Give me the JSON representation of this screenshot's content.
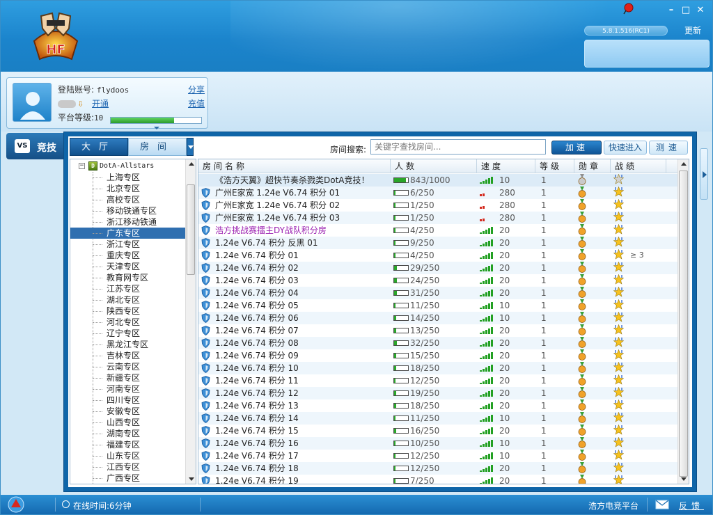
{
  "header": {
    "version": "5.8.1.516(RC1)",
    "update_label": "更新",
    "controls": [
      "minimize",
      "maximize",
      "close"
    ]
  },
  "user": {
    "account_label": "登陆账号:",
    "account": "flydoos",
    "share_label": "分享",
    "vip_open_label": "开通",
    "recharge_label": "充值",
    "level_label": "平台等级:",
    "level": "10",
    "level_progress": 0.7
  },
  "nav": {
    "compete_label": "竞技"
  },
  "tabs": {
    "hall": "大厅",
    "room": "房间"
  },
  "search": {
    "label": "房间搜索:",
    "placeholder": "关键字查找房间..."
  },
  "buttons": {
    "accelerate": "加速",
    "quick_enter": "快速进入",
    "speed_test": "测速"
  },
  "tree": {
    "root": "DotA-Allstars",
    "root_icon_letter": "D",
    "items": [
      "上海专区",
      "北京专区",
      "高校专区",
      "移动铁通专区",
      "浙江移动铁通",
      "广东专区",
      "浙江专区",
      "重庆专区",
      "天津专区",
      "教育网专区",
      "江苏专区",
      "湖北专区",
      "陕西专区",
      "河北专区",
      "辽宁专区",
      "黑龙江专区",
      "吉林专区",
      "云南专区",
      "新疆专区",
      "河南专区",
      "四川专区",
      "安徽专区",
      "山西专区",
      "湖南专区",
      "福建专区",
      "山东专区",
      "江西专区",
      "广西专区"
    ],
    "selected_index": 5
  },
  "table": {
    "columns": [
      "房间名称",
      "人数",
      "速度",
      "等级",
      "勋章",
      "战绩"
    ],
    "rows": [
      {
        "name": "《浩方天翼》超快节奏杀戮类DotA竞技！",
        "people": "843/1000",
        "fill": 0.84,
        "speed": "10",
        "sig": "green",
        "level": "1",
        "medal": "silver",
        "rec": "silver",
        "shield": false,
        "color": "#222",
        "extra": ""
      },
      {
        "name": "广州E家宽 1.24e V6.74 积分 01",
        "people": "6/250",
        "fill": 0.1,
        "speed": "280",
        "sig": "red",
        "level": "1",
        "medal": "gold",
        "rec": "gold",
        "shield": true,
        "color": "#222",
        "extra": ""
      },
      {
        "name": "广州E家宽 1.24e V6.74 积分 02",
        "people": "1/250",
        "fill": 0.05,
        "speed": "280",
        "sig": "red",
        "level": "1",
        "medal": "gold",
        "rec": "gold",
        "shield": true,
        "color": "#222",
        "extra": ""
      },
      {
        "name": "广州E家宽 1.24e V6.74 积分 03",
        "people": "1/250",
        "fill": 0.05,
        "speed": "280",
        "sig": "red",
        "level": "1",
        "medal": "gold",
        "rec": "gold",
        "shield": true,
        "color": "#222",
        "extra": ""
      },
      {
        "name": "浩方挑战赛擂主DY战队积分房",
        "people": "4/250",
        "fill": 0.08,
        "speed": "20",
        "sig": "green",
        "level": "1",
        "medal": "gold",
        "rec": "gold",
        "shield": true,
        "color": "#9b1fb0",
        "extra": ""
      },
      {
        "name": "1.24e V6.74 积分 反黑 01",
        "people": "9/250",
        "fill": 0.1,
        "speed": "20",
        "sig": "green",
        "level": "1",
        "medal": "gold",
        "rec": "gold",
        "shield": true,
        "color": "#222",
        "extra": ""
      },
      {
        "name": "1.24e V6.74 积分 01",
        "people": "4/250",
        "fill": 0.08,
        "speed": "20",
        "sig": "green",
        "level": "1",
        "medal": "gold",
        "rec": "gold",
        "shield": true,
        "color": "#222",
        "extra": "≥ 3"
      },
      {
        "name": "1.24e V6.74 积分 02",
        "people": "29/250",
        "fill": 0.2,
        "speed": "20",
        "sig": "green",
        "level": "1",
        "medal": "gold",
        "rec": "gold",
        "shield": true,
        "color": "#222",
        "extra": ""
      },
      {
        "name": "1.24e V6.74 积分 03",
        "people": "24/250",
        "fill": 0.18,
        "speed": "20",
        "sig": "green",
        "level": "1",
        "medal": "gold",
        "rec": "gold",
        "shield": true,
        "color": "#222",
        "extra": ""
      },
      {
        "name": "1.24e V6.74 积分 04",
        "people": "31/250",
        "fill": 0.22,
        "speed": "20",
        "sig": "green",
        "level": "1",
        "medal": "gold",
        "rec": "gold",
        "shield": true,
        "color": "#222",
        "extra": ""
      },
      {
        "name": "1.24e V6.74 积分 05",
        "people": "11/250",
        "fill": 0.12,
        "speed": "10",
        "sig": "green",
        "level": "1",
        "medal": "gold",
        "rec": "gold",
        "shield": true,
        "color": "#222",
        "extra": ""
      },
      {
        "name": "1.24e V6.74 积分 06",
        "people": "14/250",
        "fill": 0.14,
        "speed": "10",
        "sig": "green",
        "level": "1",
        "medal": "gold",
        "rec": "gold",
        "shield": true,
        "color": "#222",
        "extra": ""
      },
      {
        "name": "1.24e V6.74 积分 07",
        "people": "13/250",
        "fill": 0.13,
        "speed": "20",
        "sig": "green",
        "level": "1",
        "medal": "gold",
        "rec": "gold",
        "shield": true,
        "color": "#222",
        "extra": ""
      },
      {
        "name": "1.24e V6.74 积分 08",
        "people": "32/250",
        "fill": 0.22,
        "speed": "20",
        "sig": "green",
        "level": "1",
        "medal": "gold",
        "rec": "gold",
        "shield": true,
        "color": "#222",
        "extra": ""
      },
      {
        "name": "1.24e V6.74 积分 09",
        "people": "15/250",
        "fill": 0.14,
        "speed": "20",
        "sig": "green",
        "level": "1",
        "medal": "gold",
        "rec": "gold",
        "shield": true,
        "color": "#222",
        "extra": ""
      },
      {
        "name": "1.24e V6.74 积分 10",
        "people": "18/250",
        "fill": 0.16,
        "speed": "20",
        "sig": "green",
        "level": "1",
        "medal": "gold",
        "rec": "gold",
        "shield": true,
        "color": "#222",
        "extra": ""
      },
      {
        "name": "1.24e V6.74 积分 11",
        "people": "12/250",
        "fill": 0.12,
        "speed": "20",
        "sig": "green",
        "level": "1",
        "medal": "gold",
        "rec": "gold",
        "shield": true,
        "color": "#222",
        "extra": ""
      },
      {
        "name": "1.24e V6.74 积分 12",
        "people": "19/250",
        "fill": 0.16,
        "speed": "20",
        "sig": "green",
        "level": "1",
        "medal": "gold",
        "rec": "gold",
        "shield": true,
        "color": "#222",
        "extra": ""
      },
      {
        "name": "1.24e V6.74 积分 13",
        "people": "18/250",
        "fill": 0.16,
        "speed": "20",
        "sig": "green",
        "level": "1",
        "medal": "gold",
        "rec": "gold",
        "shield": true,
        "color": "#222",
        "extra": ""
      },
      {
        "name": "1.24e V6.74 积分 14",
        "people": "11/250",
        "fill": 0.12,
        "speed": "10",
        "sig": "green",
        "level": "1",
        "medal": "gold",
        "rec": "gold",
        "shield": true,
        "color": "#222",
        "extra": ""
      },
      {
        "name": "1.24e V6.74 积分 15",
        "people": "16/250",
        "fill": 0.15,
        "speed": "20",
        "sig": "green",
        "level": "1",
        "medal": "gold",
        "rec": "gold",
        "shield": true,
        "color": "#222",
        "extra": ""
      },
      {
        "name": "1.24e V6.74 积分 16",
        "people": "10/250",
        "fill": 0.11,
        "speed": "10",
        "sig": "green",
        "level": "1",
        "medal": "gold",
        "rec": "gold",
        "shield": true,
        "color": "#222",
        "extra": ""
      },
      {
        "name": "1.24e V6.74 积分 17",
        "people": "12/250",
        "fill": 0.12,
        "speed": "10",
        "sig": "green",
        "level": "1",
        "medal": "gold",
        "rec": "gold",
        "shield": true,
        "color": "#222",
        "extra": ""
      },
      {
        "name": "1.24e V6.74 积分 18",
        "people": "12/250",
        "fill": 0.12,
        "speed": "20",
        "sig": "green",
        "level": "1",
        "medal": "gold",
        "rec": "gold",
        "shield": true,
        "color": "#222",
        "extra": ""
      },
      {
        "name": "1.24e V6.74 积分 19",
        "people": "7/250",
        "fill": 0.09,
        "speed": "20",
        "sig": "green",
        "level": "1",
        "medal": "gold",
        "rec": "gold",
        "shield": true,
        "color": "#222",
        "extra": ""
      }
    ]
  },
  "status": {
    "online": "在线时间:6分钟",
    "platform": "浩方电竞平台",
    "feedback": "反馈"
  },
  "colors": {
    "accent": "#1a7fc4",
    "selected": "#2f6fb0",
    "purple_room": "#9b1fb0"
  }
}
